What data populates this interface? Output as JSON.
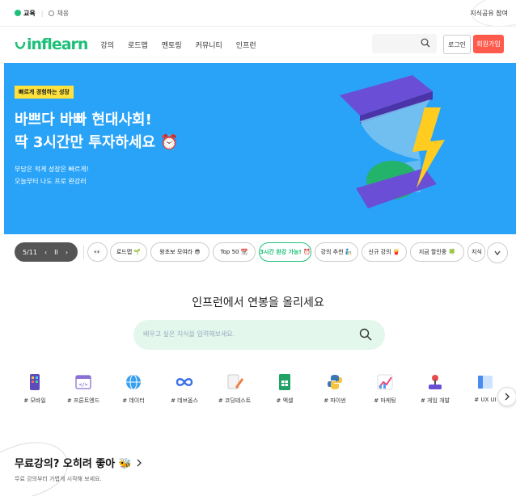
{
  "topbar": {
    "education": "교육",
    "career": "채용",
    "share": "지식공유 참여"
  },
  "header": {
    "logo": "inflearn",
    "nav": [
      "강의",
      "로드맵",
      "멘토링",
      "커뮤니티",
      "인프런"
    ],
    "login": "로그인",
    "signup": "회원가입"
  },
  "hero": {
    "tag": "빠르게 경험하는 성장",
    "title_line1": "바쁘다 바빠 현대사회!",
    "title_line2": "딱 3시간만 투자하세요 ⏰",
    "sub_line1": "부담은 적게 성장은 빠르게!",
    "sub_line2": "오늘부터 나도 프로 완강러"
  },
  "carousel": {
    "pager": "5/11",
    "prev": "‹",
    "pause": "II",
    "next": "›"
  },
  "chips": [
    {
      "label": "👀",
      "active": false
    },
    {
      "label": "로드맵 🌱",
      "active": false
    },
    {
      "label": "왕초보 모여라 😎",
      "active": false
    },
    {
      "label": "Top 50 📆",
      "active": false
    },
    {
      "label": "3시간 완강 가능! ⏰",
      "active": true
    },
    {
      "label": "강의 추천 🧞",
      "active": false
    },
    {
      "label": "신규 강의 🍟",
      "active": false
    },
    {
      "label": "지금 할인중 🍀",
      "active": false
    },
    {
      "label": "지식",
      "active": false
    }
  ],
  "main": {
    "title": "인프런에서 연봉을 올리세요",
    "search_placeholder": "배우고 싶은 지식을 입력해보세요."
  },
  "categories": [
    {
      "label": "# 모바일",
      "icon": "mobile-icon"
    },
    {
      "label": "# 프론트엔드",
      "icon": "frontend-icon"
    },
    {
      "label": "# 데이터",
      "icon": "globe-icon"
    },
    {
      "label": "# 데브옵스",
      "icon": "infinity-icon"
    },
    {
      "label": "# 코딩테스트",
      "icon": "pencil-doc-icon"
    },
    {
      "label": "# 엑셀",
      "icon": "sheet-icon"
    },
    {
      "label": "# 파이썬",
      "icon": "python-icon"
    },
    {
      "label": "# 마케팅",
      "icon": "chart-up-icon"
    },
    {
      "label": "# 게임 개발",
      "icon": "joystick-icon"
    },
    {
      "label": "# UX UI",
      "icon": "window-icon"
    }
  ],
  "section": {
    "title": "무료강의? 오히려 좋아 🐝",
    "subtitle": "무료 강의부터 가볍게 시작해 보세요."
  }
}
